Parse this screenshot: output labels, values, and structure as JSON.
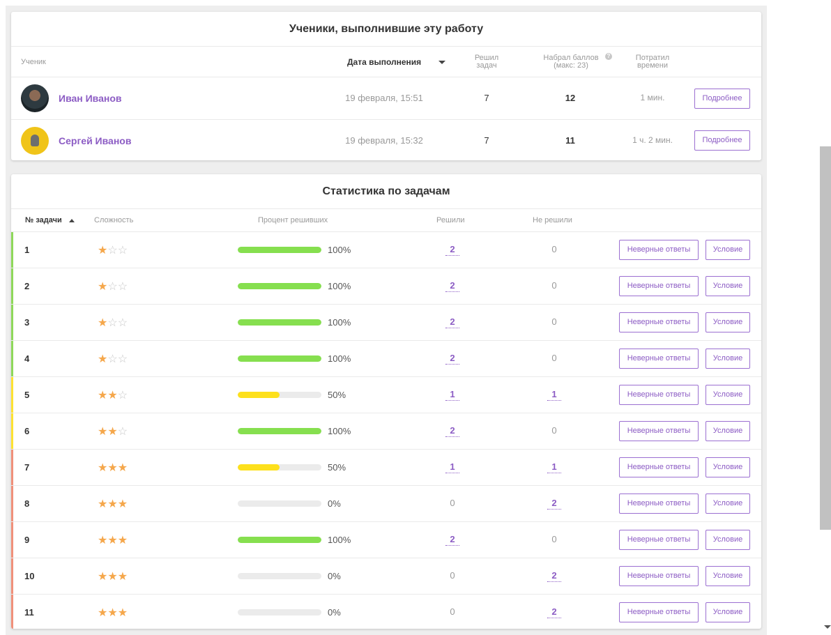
{
  "students_card": {
    "title": "Ученики, выполнившие эту работу",
    "headers": {
      "student": "Ученик",
      "date": "Дата выполнения",
      "solved": "Решил\nзадач",
      "score": "Набрал баллов\n(макс: 23)",
      "time": "Потратил\nвремени"
    },
    "students": [
      {
        "name": "Иван Иванов",
        "date": "19 февраля, 15:51",
        "solved": "7",
        "score": "12",
        "time": "1 мин.",
        "button": "Подробнее"
      },
      {
        "name": "Сергей Иванов",
        "date": "19 февраля, 15:32",
        "solved": "7",
        "score": "11",
        "time": "1 ч. 2 мин.",
        "button": "Подробнее"
      }
    ]
  },
  "stats_card": {
    "title": "Статистика по задачам",
    "headers": {
      "task_no": "№ задачи",
      "difficulty": "Сложность",
      "percent": "Процент решивших",
      "solved": "Решили",
      "not_solved": "Не решили"
    },
    "buttons": {
      "wrong_answers": "Неверные ответы",
      "condition": "Условие"
    },
    "colors": {
      "easy": "#8ed85a",
      "medium": "#fde232",
      "hard": "#f0907a",
      "bar_green": "#86df4f",
      "bar_yellow": "#fde01c",
      "accent": "#8c5cc4"
    },
    "tasks": [
      {
        "num": "1",
        "difficulty": 1,
        "percent": 100,
        "percent_label": "100%",
        "solved": "2",
        "not_solved": "0"
      },
      {
        "num": "2",
        "difficulty": 1,
        "percent": 100,
        "percent_label": "100%",
        "solved": "2",
        "not_solved": "0"
      },
      {
        "num": "3",
        "difficulty": 1,
        "percent": 100,
        "percent_label": "100%",
        "solved": "2",
        "not_solved": "0"
      },
      {
        "num": "4",
        "difficulty": 1,
        "percent": 100,
        "percent_label": "100%",
        "solved": "2",
        "not_solved": "0"
      },
      {
        "num": "5",
        "difficulty": 2,
        "percent": 50,
        "percent_label": "50%",
        "solved": "1",
        "not_solved": "1"
      },
      {
        "num": "6",
        "difficulty": 2,
        "percent": 100,
        "percent_label": "100%",
        "solved": "2",
        "not_solved": "0"
      },
      {
        "num": "7",
        "difficulty": 3,
        "percent": 50,
        "percent_label": "50%",
        "solved": "1",
        "not_solved": "1"
      },
      {
        "num": "8",
        "difficulty": 3,
        "percent": 0,
        "percent_label": "0%",
        "solved": "0",
        "not_solved": "2"
      },
      {
        "num": "9",
        "difficulty": 3,
        "percent": 100,
        "percent_label": "100%",
        "solved": "2",
        "not_solved": "0"
      },
      {
        "num": "10",
        "difficulty": 3,
        "percent": 0,
        "percent_label": "0%",
        "solved": "0",
        "not_solved": "2"
      },
      {
        "num": "11",
        "difficulty": 3,
        "percent": 0,
        "percent_label": "0%",
        "solved": "0",
        "not_solved": "2"
      }
    ]
  }
}
